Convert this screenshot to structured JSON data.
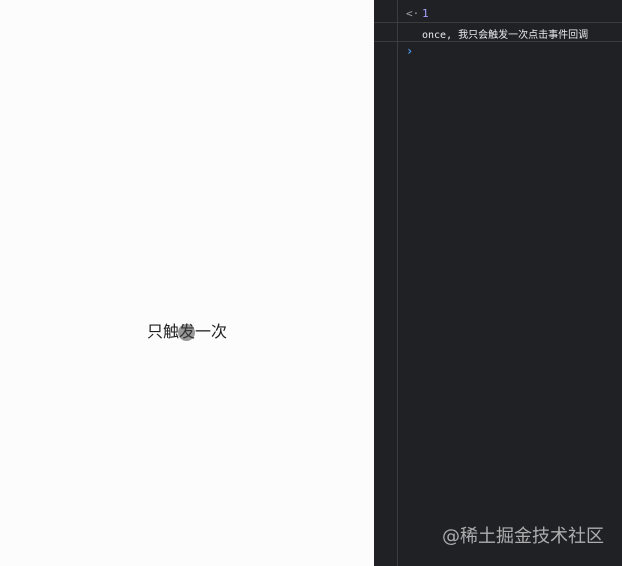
{
  "preview": {
    "button_text": "只触发一次"
  },
  "console": {
    "entries": [
      {
        "type": "return",
        "arrow": "<·",
        "value": "1"
      },
      {
        "type": "log",
        "text": "once, 我只会触发一次点击事件回调"
      }
    ],
    "prompt": "›"
  },
  "watermark": "@稀土掘金技术社区",
  "colors": {
    "console_bg": "#202124",
    "return_value": "#a8a3ff",
    "prompt_accent": "#4f9cf4"
  }
}
